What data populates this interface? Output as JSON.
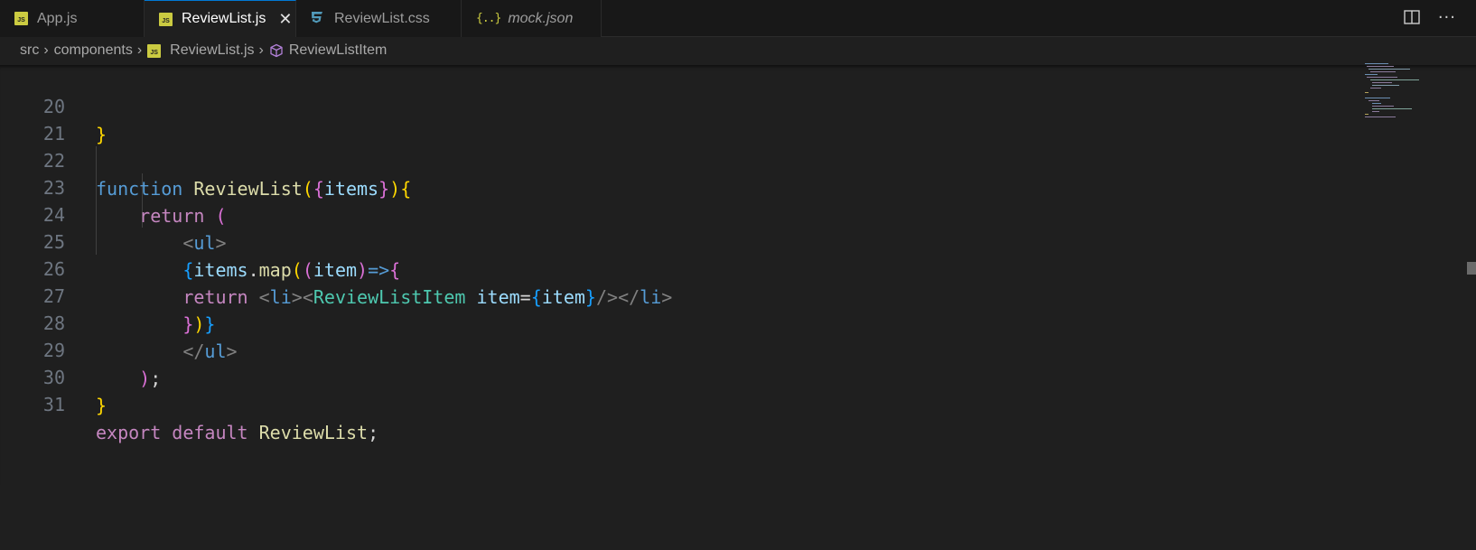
{
  "tabs": [
    {
      "label": "App.js",
      "icon": "js-file-icon",
      "active": false,
      "italic": false
    },
    {
      "label": "ReviewList.js",
      "icon": "js-file-icon",
      "active": true,
      "italic": false
    },
    {
      "label": "ReviewList.css",
      "icon": "css-file-icon",
      "active": false,
      "italic": false
    },
    {
      "label": "mock.json",
      "icon": "json-file-icon",
      "active": false,
      "italic": true
    }
  ],
  "icons": {
    "js_badge": "JS",
    "json_badge": "{..}",
    "close": "✕",
    "more": "···",
    "crumb_sep": "›"
  },
  "breadcrumb": {
    "items": [
      "src",
      "components",
      "ReviewList.js",
      "ReviewListItem"
    ]
  },
  "editor": {
    "line_numbers": [
      "20",
      "21",
      "22",
      "23",
      "24",
      "25",
      "26",
      "27",
      "28",
      "29",
      "30",
      "31"
    ],
    "code": {
      "l20_close": "}",
      "l22_function": "function",
      "l22_name": "ReviewList",
      "l22_paren_open": "(",
      "l22_brace_open": "{",
      "l22_param": "items",
      "l22_brace_close": "}",
      "l22_paren_close": ")",
      "l22_body_open": "{",
      "l23_return": "return",
      "l23_paren": "(",
      "l24_ul_open": "<",
      "l24_ul": "ul",
      "l24_ul_close": ">",
      "l25_brace": "{",
      "l25_items": "items",
      "l25_dot": ".",
      "l25_map": "map",
      "l25_paren1": "(",
      "l25_paren2": "(",
      "l25_item": "item",
      "l25_paren3": ")",
      "l25_arrow": "=>",
      "l25_body": "{",
      "l26_return": "return",
      "l26_lt1": "<",
      "l26_li": "li",
      "l26_gt1": ">",
      "l26_lt2": "<",
      "l26_comp": "ReviewListItem",
      "l26_attr": "item",
      "l26_eq": "=",
      "l26_brace_open": "{",
      "l26_item": "item",
      "l26_brace_close": "}",
      "l26_selfclose": "/>",
      "l26_lt3": "</",
      "l26_li2": "li",
      "l26_gt3": ">",
      "l27_b1": "}",
      "l27_b2": ")",
      "l27_b3": "}",
      "l28_lt": "</",
      "l28_ul": "ul",
      "l28_gt": ">",
      "l29_paren": ")",
      "l29_semi": ";",
      "l30_close": "}",
      "l31_export": "export",
      "l31_default": "default",
      "l31_name": "ReviewList",
      "l31_semi": ";"
    }
  },
  "colors": {
    "editor_bg": "#1f1f1f",
    "tab_bar_bg": "#181818",
    "active_tab_border": "#0078d4",
    "keyword": "#569cd6",
    "control": "#c586c0",
    "function": "#dcdcaa",
    "variable": "#9cdcfe",
    "component": "#4ec9b0",
    "bracket_gold": "#ffd700",
    "bracket_orchid": "#da70d6",
    "bracket_blue": "#179fff"
  }
}
